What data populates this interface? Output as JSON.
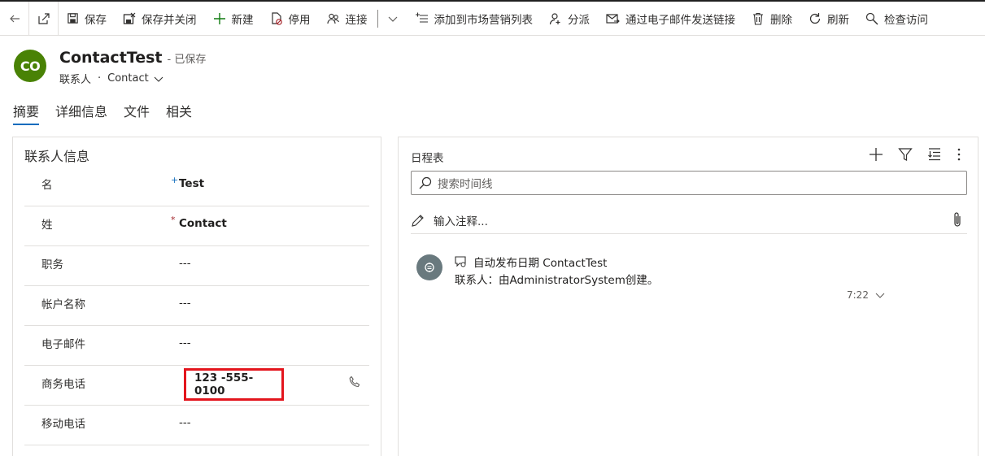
{
  "toolbar": {
    "back_icon": "arrow-left-icon",
    "popout_icon": "open-in-new-window-icon",
    "save": "保存",
    "save_and_close": "保存并关闭",
    "new": "新建",
    "deactivate": "停用",
    "connect": "连接",
    "add_to_marketing_list": "添加到市场营销列表",
    "assign": "分派",
    "email_link": "通过电子邮件发送链接",
    "delete": "删除",
    "refresh": "刷新",
    "check_access": "检查访问"
  },
  "header": {
    "avatar_initials": "CO",
    "avatar_color": "#498205",
    "title": "ContactTest",
    "saved_status": "- 已保存",
    "entity": "联系人",
    "separator": "·",
    "form": "Contact"
  },
  "tabs": [
    "摘要",
    "详细信息",
    "文件",
    "相关"
  ],
  "contact_info": {
    "section_title": "联系人信息",
    "fields": [
      {
        "label": "名",
        "required": "+",
        "value": "Test"
      },
      {
        "label": "姓",
        "required": "*",
        "value": "Contact"
      },
      {
        "label": "职务",
        "value": "---"
      },
      {
        "label": "帐户名称",
        "value": "---"
      },
      {
        "label": "电子邮件",
        "value": "---"
      },
      {
        "label": "商务电话",
        "value": "123 -555-0100"
      },
      {
        "label": "移动电话",
        "value": "---"
      }
    ]
  },
  "timeline": {
    "title": "日程表",
    "search_placeholder": "搜索时间线",
    "note_placeholder": "输入注释...",
    "activity": {
      "title": "自动发布日期 ContactTest",
      "description": "联系人：由AdministratorSystem创建。",
      "time": "7:22"
    }
  },
  "colors": {
    "accent": "#0f6cbd",
    "highlight_border": "#e3151d",
    "required_red": "#a4262c"
  }
}
